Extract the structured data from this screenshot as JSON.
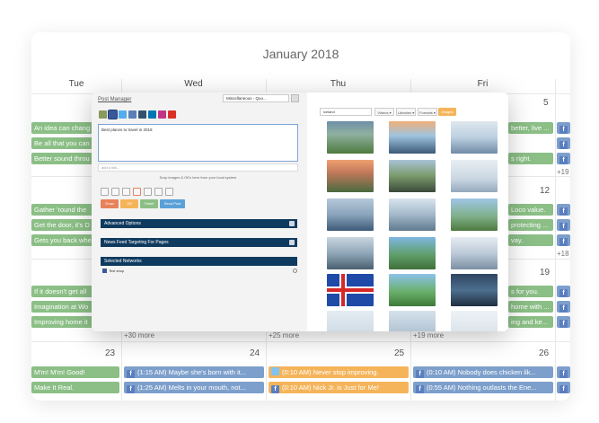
{
  "calendar": {
    "title": "January 2018",
    "days_of_week": [
      "Tue",
      "Wed",
      "Thu",
      "Fri"
    ],
    "day_numbers": [
      "5",
      "12",
      "19",
      "23",
      "24",
      "25",
      "26"
    ],
    "more_links": [
      "+30 more",
      "+25 more",
      "+19 more",
      "+19",
      "+18"
    ],
    "events": {
      "r1": [
        "An idea can chang",
        "Be all that you can",
        "Better sound throu"
      ],
      "r2": [
        "Gather 'round the",
        "Get the door, it's D",
        "Gets you back whe"
      ],
      "r3": [
        "If it doesn't get all",
        "Imagination at Wo",
        "Improving home it"
      ],
      "r1_right": [
        "better, live ...",
        "",
        "s right."
      ],
      "r2_right": [
        "Loco value.",
        "protecting ...",
        "vay."
      ],
      "r3_right": [
        "s for you.",
        "home with ...",
        "ing and ke..."
      ],
      "w23": [
        "M'm! M'm! Good!",
        "Make It Real."
      ],
      "w24": [
        "(1:15 AM)  Maybe she's born with it...",
        "(1:25 AM)  Melts in your mouth, not..."
      ],
      "w25": [
        "(0:10 AM)  Never stop improving.",
        "(0:10 AM)  Nick Jr. is Just for Me!"
      ],
      "w26": [
        "(0:10 AM)  Nobody does chicken lik...",
        "(0:55 AM)  Nothing outlasts the Ene..."
      ]
    }
  },
  "modal": {
    "title": "Post Manager",
    "category": "Miscellaneous - Quo...",
    "post_text": "Best places to travel in 2018",
    "link_placeholder": "add a link...",
    "drop_hint": "Drop images & Gif's here from your local system",
    "buttons": [
      "Draw",
      "Gif",
      "Tweet",
      "Send Post"
    ],
    "sections": [
      "Advanced Options",
      "News Feed Targeting For Pages",
      "Selected Networks"
    ],
    "network": "Test shop",
    "image_search": "iceland",
    "filters": [
      "Videos ▾",
      "Libraries ▾",
      "Formats ▾"
    ],
    "images_button": "Images",
    "colors": {
      "green_event": "#8bbf86",
      "orange_event": "#f5b45a",
      "section_bar": "#0f3a5f"
    }
  }
}
